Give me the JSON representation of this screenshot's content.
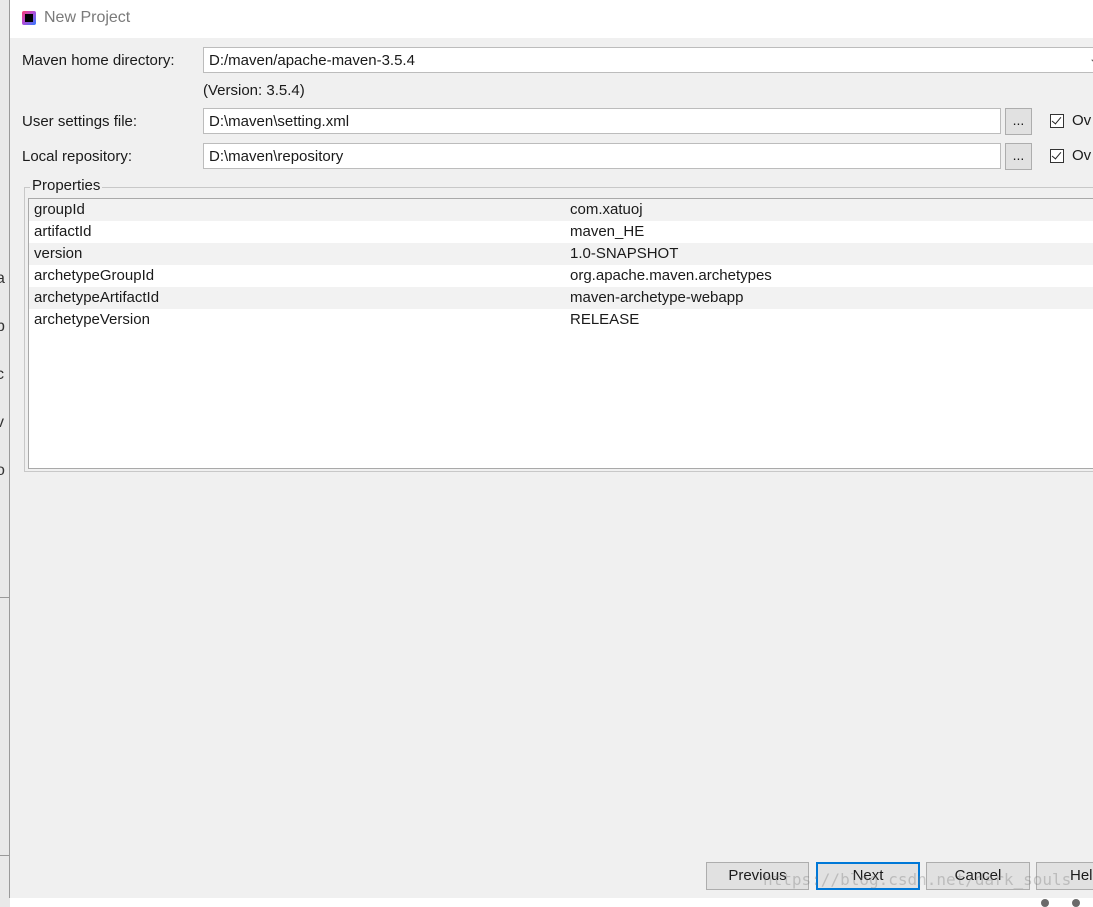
{
  "window": {
    "title": "New Project"
  },
  "background": {
    "left_edge_chars": [
      "a",
      "p",
      "c",
      "v",
      "o"
    ]
  },
  "maven": {
    "home_label": "Maven home directory:",
    "home_value": "D:/maven/apache-maven-3.5.4",
    "version_note": "(Version: 3.5.4)",
    "settings_label": "User settings file:",
    "settings_value": "D:\\maven\\setting.xml",
    "settings_browse": "...",
    "settings_override_label": "Ov",
    "settings_override_checked": true,
    "repo_label": "Local repository:",
    "repo_value": "D:\\maven\\repository",
    "repo_browse": "...",
    "repo_override_label": "Ov",
    "repo_override_checked": true
  },
  "properties": {
    "legend": "Properties",
    "rows": [
      {
        "key": "groupId",
        "value": "com.xatuoj"
      },
      {
        "key": "artifactId",
        "value": "maven_HE"
      },
      {
        "key": "version",
        "value": "1.0-SNAPSHOT"
      },
      {
        "key": "archetypeGroupId",
        "value": "org.apache.maven.archetypes"
      },
      {
        "key": "archetypeArtifactId",
        "value": "maven-archetype-webapp"
      },
      {
        "key": "archetypeVersion",
        "value": "RELEASE"
      }
    ]
  },
  "buttons": {
    "previous": "Previous",
    "next": "Next",
    "cancel": "Cancel",
    "help": "Hel"
  },
  "watermark": "https://blog.csdn.net/dark_souls",
  "colors": {
    "dialog_bg": "#f0f0f0",
    "default_button_border": "#0078d7"
  }
}
